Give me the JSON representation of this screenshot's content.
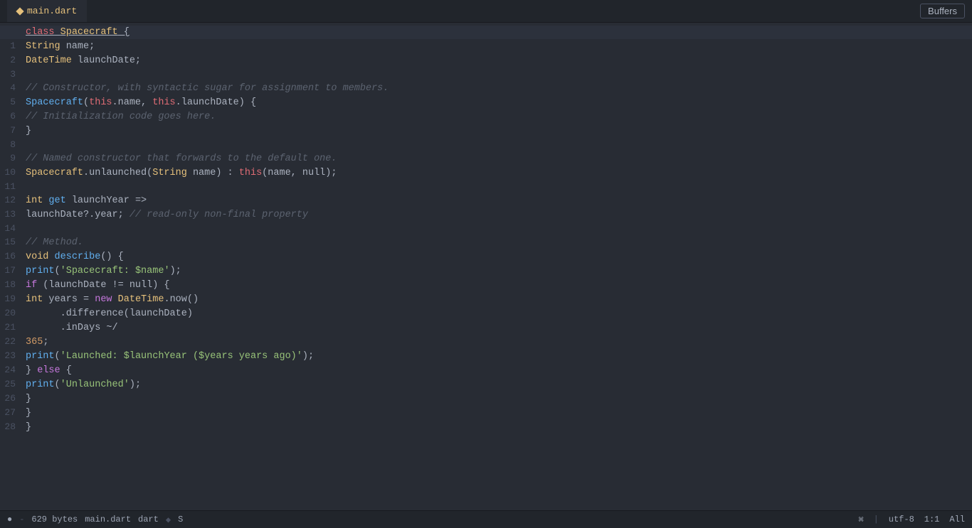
{
  "titlebar": {
    "tab_label": "main.dart",
    "buffers_label": "Buffers"
  },
  "statusbar": {
    "info_icon": "●",
    "file_size": "629 bytes",
    "filename": "main.dart",
    "filetype": "dart",
    "git_icon": "◆",
    "git_branch": "S",
    "encoding": "utf-8",
    "position": "1:1",
    "indent": "All",
    "linux_icon": "⌘"
  },
  "code": {
    "lines": [
      {
        "n": "",
        "tokens": [
          {
            "t": "kw-class",
            "v": "class"
          },
          {
            "t": "punct",
            "v": " "
          },
          {
            "t": "class-name",
            "v": "Spacecraft"
          },
          {
            "t": "punct",
            "v": " {"
          }
        ]
      },
      {
        "n": "1",
        "tokens": [
          {
            "t": "kw-type",
            "v": "String"
          },
          {
            "t": "punct",
            "v": " name;"
          }
        ]
      },
      {
        "n": "2",
        "tokens": [
          {
            "t": "kw-type",
            "v": "DateTime"
          },
          {
            "t": "punct",
            "v": " launchDate;"
          }
        ]
      },
      {
        "n": "3",
        "tokens": []
      },
      {
        "n": "4",
        "tokens": [
          {
            "t": "comment",
            "v": "// Constructor, with syntactic sugar for assignment to members."
          }
        ]
      },
      {
        "n": "5",
        "tokens": [
          {
            "t": "fn-name",
            "v": "Spacecraft"
          },
          {
            "t": "punct",
            "v": "("
          },
          {
            "t": "kw-this",
            "v": "this"
          },
          {
            "t": "punct",
            "v": ".name, "
          },
          {
            "t": "kw-this",
            "v": "this"
          },
          {
            "t": "punct",
            "v": ".launchDate) {"
          }
        ]
      },
      {
        "n": "6",
        "tokens": [
          {
            "t": "comment",
            "v": "// Initialization code goes here."
          }
        ]
      },
      {
        "n": "7",
        "tokens": [
          {
            "t": "punct",
            "v": "}"
          }
        ]
      },
      {
        "n": "8",
        "tokens": []
      },
      {
        "n": "9",
        "tokens": [
          {
            "t": "comment",
            "v": "// Named constructor that forwards to the default one."
          }
        ]
      },
      {
        "n": "10",
        "tokens": [
          {
            "t": "class-name",
            "v": "Spacecraft"
          },
          {
            "t": "punct",
            "v": ".unlaunched("
          },
          {
            "t": "kw-type",
            "v": "String"
          },
          {
            "t": "punct",
            "v": " name) : "
          },
          {
            "t": "kw-this",
            "v": "this"
          },
          {
            "t": "punct",
            "v": "(name, null);"
          }
        ]
      },
      {
        "n": "11",
        "tokens": []
      },
      {
        "n": "12",
        "tokens": [
          {
            "t": "kw-type",
            "v": "int"
          },
          {
            "t": "punct",
            "v": " "
          },
          {
            "t": "kw-get",
            "v": "get"
          },
          {
            "t": "punct",
            "v": " launchYear =>"
          },
          {
            "t": "punct",
            "v": ""
          }
        ]
      },
      {
        "n": "13",
        "tokens": [
          {
            "t": "punct",
            "v": "launchDate?.year; "
          },
          {
            "t": "comment",
            "v": "// read-only non-final property"
          }
        ]
      },
      {
        "n": "14",
        "tokens": []
      },
      {
        "n": "15",
        "tokens": [
          {
            "t": "comment",
            "v": "// Method."
          }
        ]
      },
      {
        "n": "16",
        "tokens": [
          {
            "t": "kw-type",
            "v": "void"
          },
          {
            "t": "punct",
            "v": " "
          },
          {
            "t": "fn-name",
            "v": "describe"
          },
          {
            "t": "punct",
            "v": "() {"
          }
        ]
      },
      {
        "n": "17",
        "tokens": [
          {
            "t": "fn-name",
            "v": "print"
          },
          {
            "t": "punct",
            "v": "("
          },
          {
            "t": "str",
            "v": "'Spacecraft: $name'"
          },
          {
            "t": "punct",
            "v": ");"
          }
        ]
      },
      {
        "n": "18",
        "tokens": [
          {
            "t": "kw-ctrl",
            "v": "if"
          },
          {
            "t": "punct",
            "v": " (launchDate != null) {"
          }
        ]
      },
      {
        "n": "19",
        "tokens": [
          {
            "t": "kw-type",
            "v": "int"
          },
          {
            "t": "punct",
            "v": " years = "
          },
          {
            "t": "kw-ctrl",
            "v": "new"
          },
          {
            "t": "punct",
            "v": " "
          },
          {
            "t": "class-name",
            "v": "DateTime"
          },
          {
            "t": "punct",
            "v": ".now()"
          }
        ]
      },
      {
        "n": "20",
        "tokens": [
          {
            "t": "punct",
            "v": "      .difference(launchDate)"
          }
        ]
      },
      {
        "n": "21",
        "tokens": [
          {
            "t": "punct",
            "v": "      .inDays ~/"
          }
        ]
      },
      {
        "n": "22",
        "tokens": [
          {
            "t": "num",
            "v": "365"
          },
          {
            "t": "punct",
            "v": ";"
          }
        ]
      },
      {
        "n": "23",
        "tokens": [
          {
            "t": "fn-name",
            "v": "print"
          },
          {
            "t": "punct",
            "v": "("
          },
          {
            "t": "str",
            "v": "'Launched: $launchYear ($years years ago)'"
          },
          {
            "t": "punct",
            "v": ");"
          }
        ]
      },
      {
        "n": "24",
        "tokens": [
          {
            "t": "punct",
            "v": "} "
          },
          {
            "t": "kw-ctrl",
            "v": "else"
          },
          {
            "t": "punct",
            "v": " {"
          }
        ]
      },
      {
        "n": "25",
        "tokens": [
          {
            "t": "fn-name",
            "v": "print"
          },
          {
            "t": "punct",
            "v": "("
          },
          {
            "t": "str",
            "v": "'Unlaunched'"
          },
          {
            "t": "punct",
            "v": ");"
          }
        ]
      },
      {
        "n": "26",
        "tokens": [
          {
            "t": "punct",
            "v": "}"
          }
        ]
      },
      {
        "n": "27",
        "tokens": [
          {
            "t": "punct",
            "v": "}"
          }
        ]
      },
      {
        "n": "28",
        "tokens": [
          {
            "t": "punct",
            "v": "}"
          }
        ]
      }
    ]
  }
}
